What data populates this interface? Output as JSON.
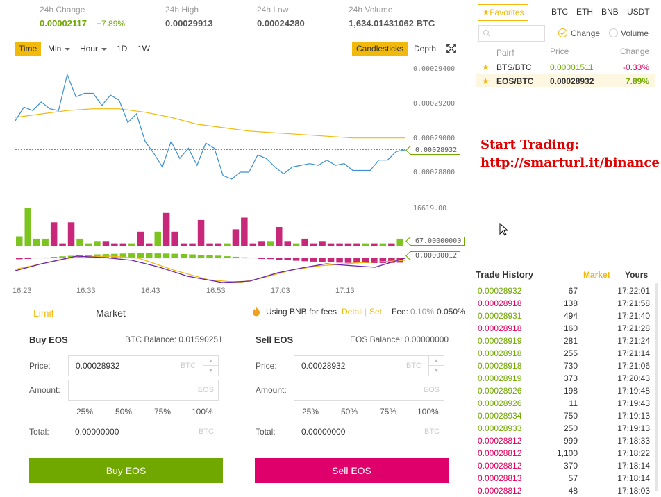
{
  "stats": {
    "change_label": "24h Change",
    "change_value": "0.00002117",
    "change_pct": "+7.89%",
    "high_label": "24h High",
    "high_value": "0.00029913",
    "low_label": "24h Low",
    "low_value": "0.00024280",
    "volume_label": "24h Volume",
    "volume_value": "1,634.01431062 BTC"
  },
  "toolbar": {
    "time": "Time",
    "min": "Min",
    "hour": "Hour",
    "d1": "1D",
    "w1": "1W",
    "candlesticks": "Candlesticks",
    "depth": "Depth"
  },
  "chart_data": {
    "type": "line",
    "x_ticks": [
      "16:23",
      "16:33",
      "16:43",
      "16:53",
      "17:03",
      "17:13"
    ],
    "price_axis": [
      "0.00029400",
      "0.00029200",
      "0.00029000",
      "0.00028800"
    ],
    "price_tags": [
      "0.00029000",
      "0.00028932"
    ],
    "volume_axis": "16619.00",
    "volume_tag": "67.00000000",
    "macd_tag": "0.00000012",
    "price_series": [
      0.000291,
      0.0002918,
      0.0002916,
      0.0002921,
      0.0002917,
      0.0002916,
      0.0002937,
      0.0002924,
      0.0002926,
      0.0002926,
      0.0002919,
      0.0002925,
      0.0002922,
      0.0002909,
      0.0002914,
      0.0002898,
      0.0002891,
      0.0002883,
      0.0002898,
      0.0002888,
      0.0002894,
      0.0002884,
      0.0002897,
      0.0002894,
      0.0002878,
      0.0002876,
      0.000288,
      0.000288,
      0.000289,
      0.0002888,
      0.0002883,
      0.0002879,
      0.0002883,
      0.0002884,
      0.0002885,
      0.0002884,
      0.0002887,
      0.0002884,
      0.0002885,
      0.0002881,
      0.0002881,
      0.0002881,
      0.0002887,
      0.0002887,
      0.0002892,
      0.0002893
    ],
    "ma_series": [
      0.0002912,
      0.0002914,
      0.0002916,
      0.0002917,
      0.0002917,
      0.0002915,
      0.0002912,
      0.0002908,
      0.0002906,
      0.0002904,
      0.0002903,
      0.0002902,
      0.0002901,
      0.00029,
      0.00029,
      0.00029
    ],
    "volume_bars": [
      {
        "v": 4,
        "c": "g"
      },
      {
        "v": 16,
        "c": "g"
      },
      {
        "v": 3,
        "c": "g"
      },
      {
        "v": 3,
        "c": "g"
      },
      {
        "v": 10,
        "c": "m"
      },
      {
        "v": 1,
        "c": "m"
      },
      {
        "v": 10,
        "c": "m"
      },
      {
        "v": 3,
        "c": "g"
      },
      {
        "v": 1,
        "c": "g"
      },
      {
        "v": 2,
        "c": "g"
      },
      {
        "v": 2,
        "c": "m"
      },
      {
        "v": 1,
        "c": "m"
      },
      {
        "v": 1,
        "c": "m"
      },
      {
        "v": 1,
        "c": "g"
      },
      {
        "v": 6,
        "c": "m"
      },
      {
        "v": 1,
        "c": "m"
      },
      {
        "v": 6,
        "c": "g"
      },
      {
        "v": 14,
        "c": "m"
      },
      {
        "v": 6,
        "c": "m"
      },
      {
        "v": 1,
        "c": "m"
      },
      {
        "v": 1,
        "c": "m"
      },
      {
        "v": 11,
        "c": "m"
      },
      {
        "v": 1,
        "c": "m"
      },
      {
        "v": 1,
        "c": "m"
      },
      {
        "v": 1,
        "c": "g"
      },
      {
        "v": 7,
        "c": "m"
      },
      {
        "v": 12,
        "c": "m"
      },
      {
        "v": 1,
        "c": "m"
      },
      {
        "v": 2,
        "c": "m"
      },
      {
        "v": 2,
        "c": "g"
      },
      {
        "v": 8,
        "c": "m"
      },
      {
        "v": 2,
        "c": "m"
      },
      {
        "v": 1,
        "c": "g"
      },
      {
        "v": 3,
        "c": "m"
      },
      {
        "v": 1,
        "c": "m"
      },
      {
        "v": 2,
        "c": "m"
      },
      {
        "v": 1,
        "c": "m"
      },
      {
        "v": 1,
        "c": "m"
      },
      {
        "v": 1,
        "c": "m"
      },
      {
        "v": 1,
        "c": "m"
      },
      {
        "v": 1,
        "c": "g"
      },
      {
        "v": 1,
        "c": "m"
      },
      {
        "v": 1,
        "c": "g"
      },
      {
        "v": 1,
        "c": "m"
      },
      {
        "v": 3,
        "c": "g"
      }
    ]
  },
  "form_tabs": {
    "limit": "Limit",
    "market": "Market",
    "bnb_fee": "Using BNB for fees",
    "detail": "Detail",
    "set": "Set",
    "fee_label": "Fee:",
    "fee_old": "0.10%",
    "fee_new": "0.050%"
  },
  "buy": {
    "title": "Buy EOS",
    "balance": "BTC Balance: 0.01590251",
    "price_label": "Price:",
    "price_value": "0.00028932",
    "price_unit": "BTC",
    "amount_label": "Amount:",
    "amount_unit": "EOS",
    "pcts": [
      "25%",
      "50%",
      "75%",
      "100%"
    ],
    "total_label": "Total:",
    "total_value": "0.00000000",
    "total_unit": "BTC",
    "button": "Buy EOS"
  },
  "sell": {
    "title": "Sell EOS",
    "balance": "EOS Balance: 0.00000000",
    "price_label": "Price:",
    "price_value": "0.00028932",
    "price_unit": "BTC",
    "amount_label": "Amount:",
    "amount_unit": "EOS",
    "pcts": [
      "25%",
      "50%",
      "75%",
      "100%"
    ],
    "total_label": "Total:",
    "total_value": "0.00000000",
    "total_unit": "BTC",
    "button": "Sell EOS"
  },
  "markets": {
    "favorites": "Favorites",
    "tabs": [
      "BTC",
      "ETH",
      "BNB",
      "USDT"
    ],
    "change_toggle": "Change",
    "volume_toggle": "Volume",
    "headers": {
      "pair": "Pair",
      "price": "Price",
      "change": "Change"
    },
    "rows": [
      {
        "pair": "BTS/BTC",
        "price": "0.00001511",
        "change": "-0.33%"
      },
      {
        "pair": "EOS/BTC",
        "price": "0.00028932",
        "change": "7.89%"
      }
    ]
  },
  "promo": {
    "line1": "Start Trading:",
    "line2": "http://smarturl.it/binance"
  },
  "trade_history": {
    "title": "Trade History",
    "tab_market": "Market",
    "tab_yours": "Yours",
    "rows": [
      {
        "price": "0.00028932",
        "amount": "67",
        "time": "17:22:01",
        "side": "buy"
      },
      {
        "price": "0.00028918",
        "amount": "138",
        "time": "17:21:58",
        "side": "sell"
      },
      {
        "price": "0.00028931",
        "amount": "494",
        "time": "17:21:40",
        "side": "buy"
      },
      {
        "price": "0.00028918",
        "amount": "160",
        "time": "17:21:28",
        "side": "sell"
      },
      {
        "price": "0.00028919",
        "amount": "281",
        "time": "17:21:24",
        "side": "buy"
      },
      {
        "price": "0.00028918",
        "amount": "255",
        "time": "17:21:14",
        "side": "buy"
      },
      {
        "price": "0.00028918",
        "amount": "730",
        "time": "17:21:06",
        "side": "buy"
      },
      {
        "price": "0.00028919",
        "amount": "373",
        "time": "17:20:43",
        "side": "buy"
      },
      {
        "price": "0.00028926",
        "amount": "198",
        "time": "17:19:48",
        "side": "buy"
      },
      {
        "price": "0.00028926",
        "amount": "11",
        "time": "17:19:43",
        "side": "buy"
      },
      {
        "price": "0.00028934",
        "amount": "750",
        "time": "17:19:13",
        "side": "buy"
      },
      {
        "price": "0.00028933",
        "amount": "250",
        "time": "17:19:13",
        "side": "buy"
      },
      {
        "price": "0.00028812",
        "amount": "999",
        "time": "17:18:33",
        "side": "sell"
      },
      {
        "price": "0.00028812",
        "amount": "1,100",
        "time": "17:18:22",
        "side": "sell"
      },
      {
        "price": "0.00028812",
        "amount": "370",
        "time": "17:18:14",
        "side": "sell"
      },
      {
        "price": "0.00028813",
        "amount": "57",
        "time": "17:18:14",
        "side": "sell"
      },
      {
        "price": "0.00028812",
        "amount": "48",
        "time": "17:18:03",
        "side": "sell"
      }
    ]
  },
  "colors": {
    "accent": "#f0b90b",
    "buy": "#70a800",
    "sell": "#e0005c",
    "promo": "#e00000"
  }
}
